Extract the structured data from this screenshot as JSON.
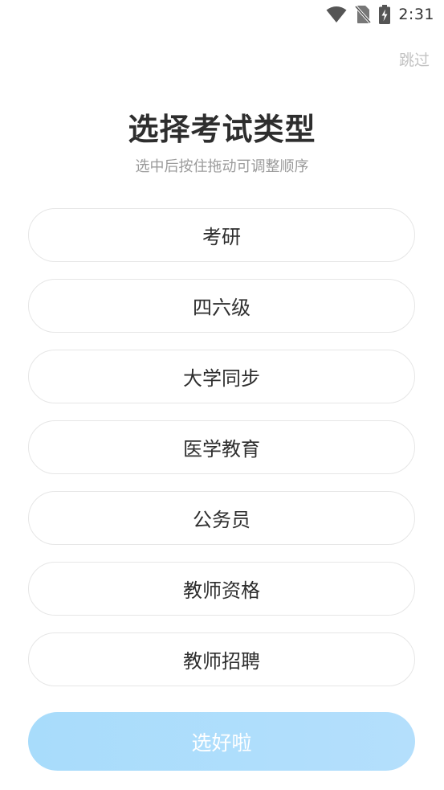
{
  "status_bar": {
    "time": "2:31",
    "icons": [
      "wifi-icon",
      "no-sim-icon",
      "battery-charging-icon"
    ]
  },
  "skip_label": "跳过",
  "title": "选择考试类型",
  "subtitle": "选中后按住拖动可调整顺序",
  "options": [
    {
      "label": "考研"
    },
    {
      "label": "四六级"
    },
    {
      "label": "大学同步"
    },
    {
      "label": "医学教育"
    },
    {
      "label": "公务员"
    },
    {
      "label": "教师资格"
    },
    {
      "label": "教师招聘"
    }
  ],
  "confirm_label": "选好啦",
  "colors": {
    "confirm_button": "#a8dcfb",
    "option_border": "#e6e6e6",
    "skip_text": "#c3c3c3"
  }
}
